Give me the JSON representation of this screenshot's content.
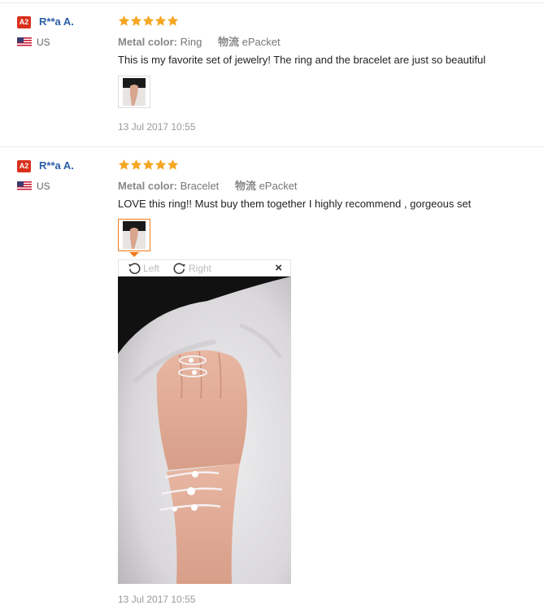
{
  "reviews": [
    {
      "badge": "A2",
      "name": "R**a A.",
      "country": "US",
      "rating_stars": 5,
      "attr_key": "Metal color:",
      "attr_value": "Ring",
      "shipping_key": "物流",
      "shipping_value": "ePacket",
      "feedback": "This is my favorite set of jewelry! The ring and the bracelet are just so beautiful",
      "date": "13 Jul 2017 10:55"
    },
    {
      "badge": "A2",
      "name": "R**a A.",
      "country": "US",
      "rating_stars": 5,
      "attr_key": "Metal color:",
      "attr_value": "Bracelet",
      "shipping_key": "物流",
      "shipping_value": "ePacket",
      "feedback": "LOVE this ring!! Must buy them together I highly recommend , gorgeous set",
      "date": "13 Jul 2017 10:55"
    }
  ],
  "viewer": {
    "rotate_left": "Left",
    "rotate_right": "Right",
    "close": "×"
  },
  "colors": {
    "star": "#f5a623",
    "badge": "#d9301c",
    "name": "#2a5ea8",
    "active_border": "#f27a1a"
  }
}
